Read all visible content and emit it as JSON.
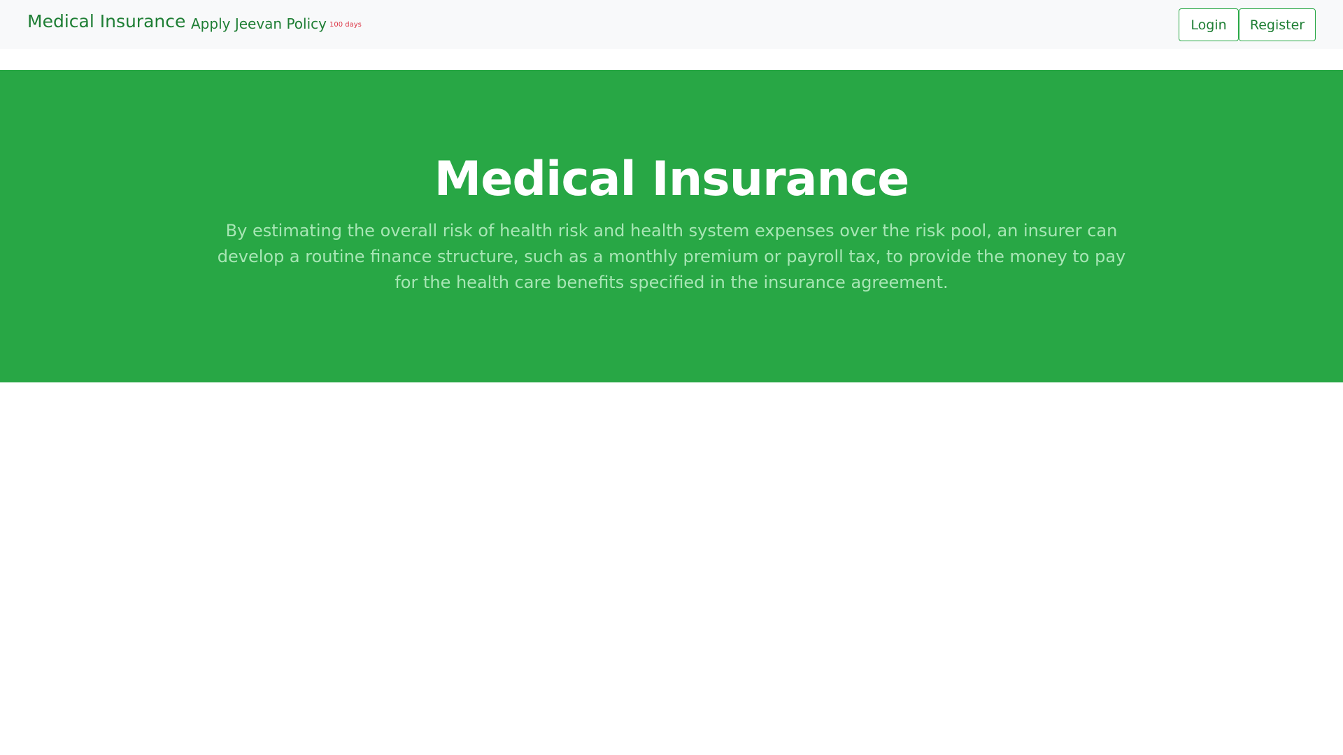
{
  "navbar": {
    "brand": "Medical Insurance",
    "link_label": "Apply Jeevan Policy",
    "link_badge": "100 days",
    "login_label": "Login",
    "register_label": "Register"
  },
  "hero": {
    "title": "Medical Insurance",
    "description": "By estimating the overall risk of health risk and health system expenses over the risk pool, an insurer can develop a routine finance structure, such as a monthly premium or payroll tax, to provide the money to pay for the health care benefits specified in the insurance agreement."
  },
  "colors": {
    "brand_green": "#28a745",
    "nav_text_green": "#1e7e34",
    "badge_red": "#dc3545",
    "navbar_bg": "#f8f9fa"
  }
}
